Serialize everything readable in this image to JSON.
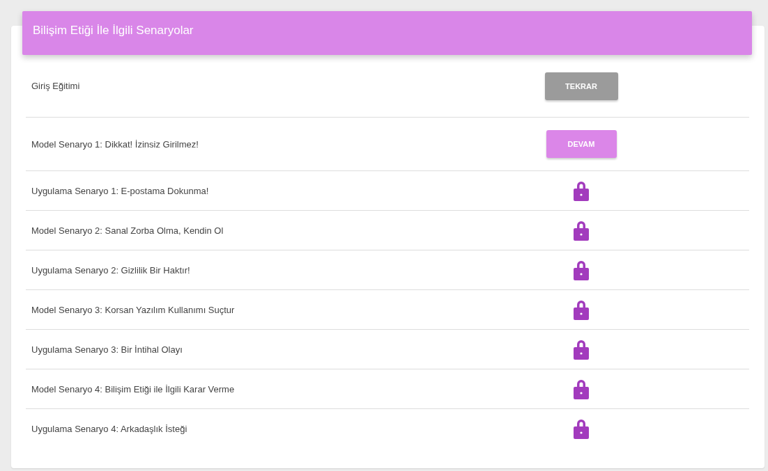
{
  "header": {
    "title": "Bilişim Etiği İle İlgili Senaryolar"
  },
  "rows": [
    {
      "title": "Giriş Eğitimi",
      "kind": "repeat",
      "action": "TEKRAR"
    },
    {
      "title": "Model Senaryo 1: Dikkat! İzinsiz Girilmez!",
      "kind": "continue",
      "action": "DEVAM"
    },
    {
      "title": "Uygulama Senaryo 1: E-postama Dokunma!",
      "kind": "locked"
    },
    {
      "title": "Model Senaryo 2: Sanal Zorba Olma, Kendin Ol",
      "kind": "locked"
    },
    {
      "title": "Uygulama Senaryo 2: Gizlilik Bir Haktır!",
      "kind": "locked"
    },
    {
      "title": "Model Senaryo 3: Korsan Yazılım Kullanımı Suçtur",
      "kind": "locked"
    },
    {
      "title": "Uygulama Senaryo 3: Bir İntihal Olayı",
      "kind": "locked"
    },
    {
      "title": "Model Senaryo 4: Bilişim Etiği ile İlgili Karar Verme",
      "kind": "locked"
    },
    {
      "title": "Uygulama Senaryo 4: Arkadaşlık İsteği",
      "kind": "locked"
    }
  ]
}
